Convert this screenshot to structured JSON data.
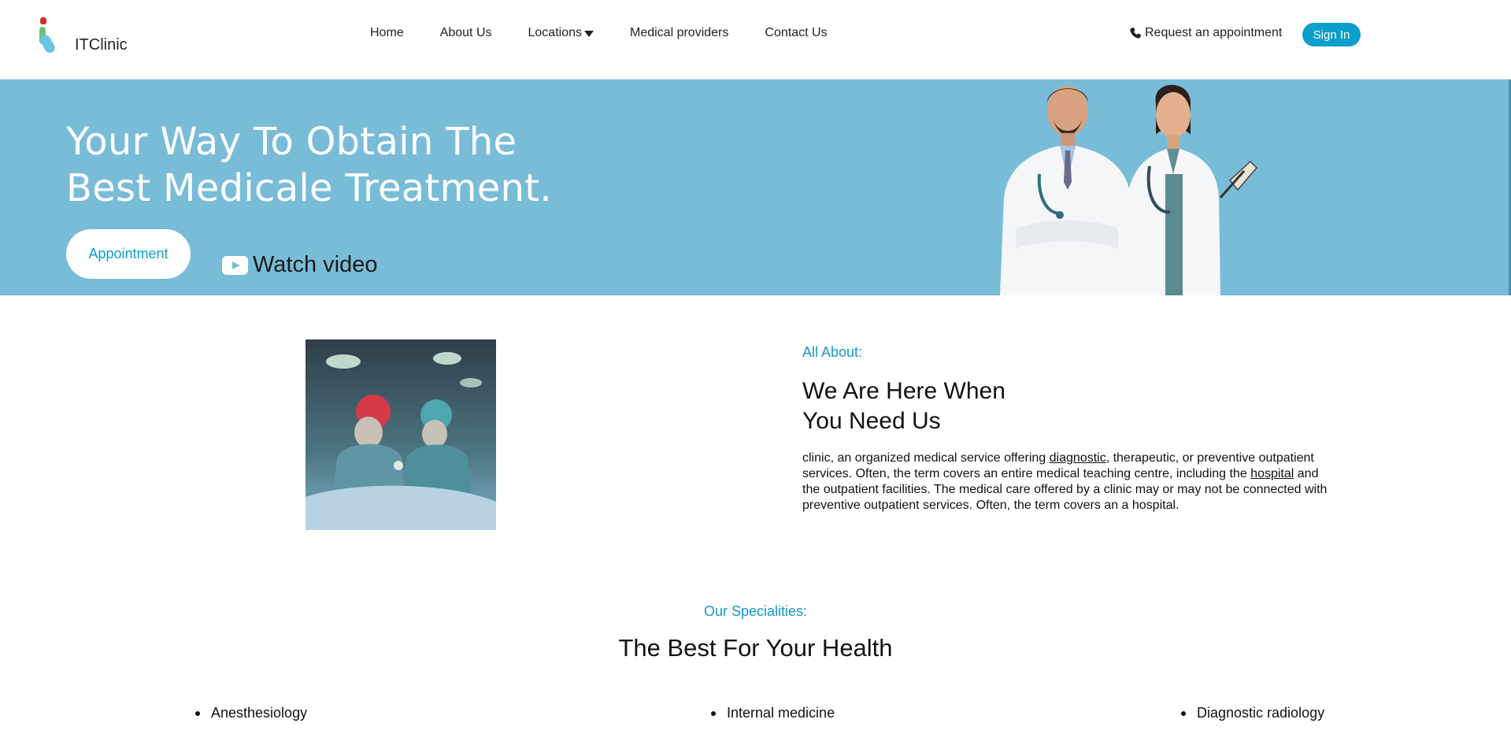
{
  "header": {
    "brand": "ITClinic",
    "nav": [
      "Home",
      "About Us",
      "Locations",
      "Medical providers",
      "Contact Us"
    ],
    "request_label": "Request an appointment",
    "signin_label": "Sign In",
    "icons": {
      "logo": "itclinic-logo",
      "phone": "phone-icon",
      "caret": "caret-down-icon"
    }
  },
  "hero": {
    "title_line1": "Your Way To Obtain The",
    "title_line2": "Best Medicale Treatment.",
    "appointment_label": "Appointment",
    "watch_label": "Watch video",
    "background": "#79bcd8"
  },
  "about": {
    "eyebrow": "All About:",
    "title_line1": "We Are Here When",
    "title_line2": "You Need Us",
    "text_part1": "clinic, an organized medical service offering ",
    "link1": "diagnostic",
    "text_part2": ", therapeutic, or preventive outpatient services. Often, the term covers an entire medical teaching centre, including the ",
    "link2": "hospital",
    "text_part3": " and the outpatient facilities. The medical care offered by a clinic may or may not be connected with preventive outpatient services. Often, the term covers an a hospital."
  },
  "specialities": {
    "eyebrow": "Our Specialities:",
    "title": "The Best For Your Health",
    "items": [
      "Anesthesiology",
      "Internal medicine",
      "Diagnostic radiology"
    ]
  },
  "colors": {
    "accent": "#0d9ecb",
    "eyebrow": "#1597c4"
  }
}
